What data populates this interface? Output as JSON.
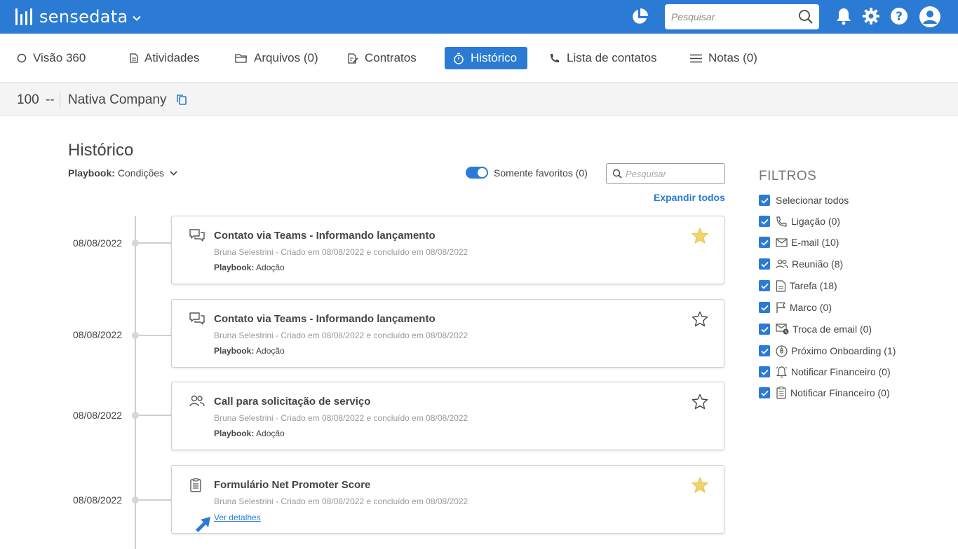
{
  "header": {
    "app_name": "sensedata",
    "search_placeholder": "Pesquisar",
    "icons": [
      "pie-chart-icon",
      "search-icon",
      "bell-icon",
      "gear-icon",
      "help-icon",
      "user-avatar-icon"
    ],
    "brand_color": "#2b7bd4"
  },
  "tabs": [
    {
      "label": "Visão 360",
      "icon": "circle-icon",
      "active": false
    },
    {
      "label": "Atividades",
      "icon": "document-icon",
      "active": false
    },
    {
      "label": "Arquivos (0)",
      "icon": "folder-icon",
      "active": false
    },
    {
      "label": "Contratos",
      "icon": "contract-icon",
      "active": false
    },
    {
      "label": "Histórico",
      "icon": "stopwatch-icon",
      "active": true
    },
    {
      "label": "Lista de contatos",
      "icon": "phone-icon",
      "active": false
    },
    {
      "label": "Notas (0)",
      "icon": "menu-icon",
      "active": false
    }
  ],
  "company": {
    "id": "100",
    "dash": "--",
    "name": "Nativa Company"
  },
  "history": {
    "title": "Histórico",
    "playbook_label": "Playbook:",
    "playbook_value": "Condições",
    "favorites_toggle_label": "Somente favoritos (0)",
    "favorites_toggle_on": true,
    "search_placeholder": "Pesquisar",
    "expand_all": "Expandir todos",
    "items": [
      {
        "date": "08/08/2022",
        "icon": "chat-icon",
        "title": "Contato via Teams - Informando lançamento",
        "meta": "Bruna Selestrini - Criado em 08/08/2022 e concluído em 08/08/2022",
        "playbook": "Playbook: Adoção",
        "favorite": true
      },
      {
        "date": "08/08/2022",
        "icon": "chat-icon",
        "title": "Contato via Teams - Informando lançamento",
        "meta": "Bruna Selestrini - Criado em 08/08/2022 e concluído em 08/08/2022",
        "playbook": "Playbook: Adoção",
        "favorite": false
      },
      {
        "date": "08/08/2022",
        "icon": "people-icon",
        "title": "Call para solicitação de serviço",
        "meta": "Bruna Selestrini - Criado em 08/08/2022 e concluído em 08/08/2022",
        "playbook": "Playbook: Adoção",
        "favorite": false
      },
      {
        "date": "08/08/2022",
        "icon": "form-icon",
        "title": "Formulário Net Promoter Score",
        "meta": "Bruna Selestrini - Criado em 08/08/2022 e concluído em 08/08/2022",
        "link": "Ver detalhes",
        "favorite": true
      }
    ]
  },
  "filters": {
    "title": "FILTROS",
    "items": [
      {
        "label": "Selecionar todos",
        "icon": "",
        "checked": true
      },
      {
        "label": "Ligação (0)",
        "icon": "phone-icon",
        "checked": true
      },
      {
        "label": "E-mail (10)",
        "icon": "mail-icon",
        "checked": true
      },
      {
        "label": "Reunião (8)",
        "icon": "people-icon",
        "checked": true
      },
      {
        "label": "Tarefa (18)",
        "icon": "document-icon",
        "checked": true
      },
      {
        "label": "Marco (0)",
        "icon": "flag-icon",
        "checked": true
      },
      {
        "label": "Troca de email (0)",
        "icon": "mail-clock-icon",
        "checked": true
      },
      {
        "label": "Próximo Onboarding (1)",
        "icon": "rocket-icon",
        "checked": true
      },
      {
        "label": "Notificar Financeiro (0)",
        "icon": "bell-icon",
        "checked": true
      },
      {
        "label": "Notificar Financeiro (0)",
        "icon": "form-icon",
        "checked": true
      }
    ]
  }
}
